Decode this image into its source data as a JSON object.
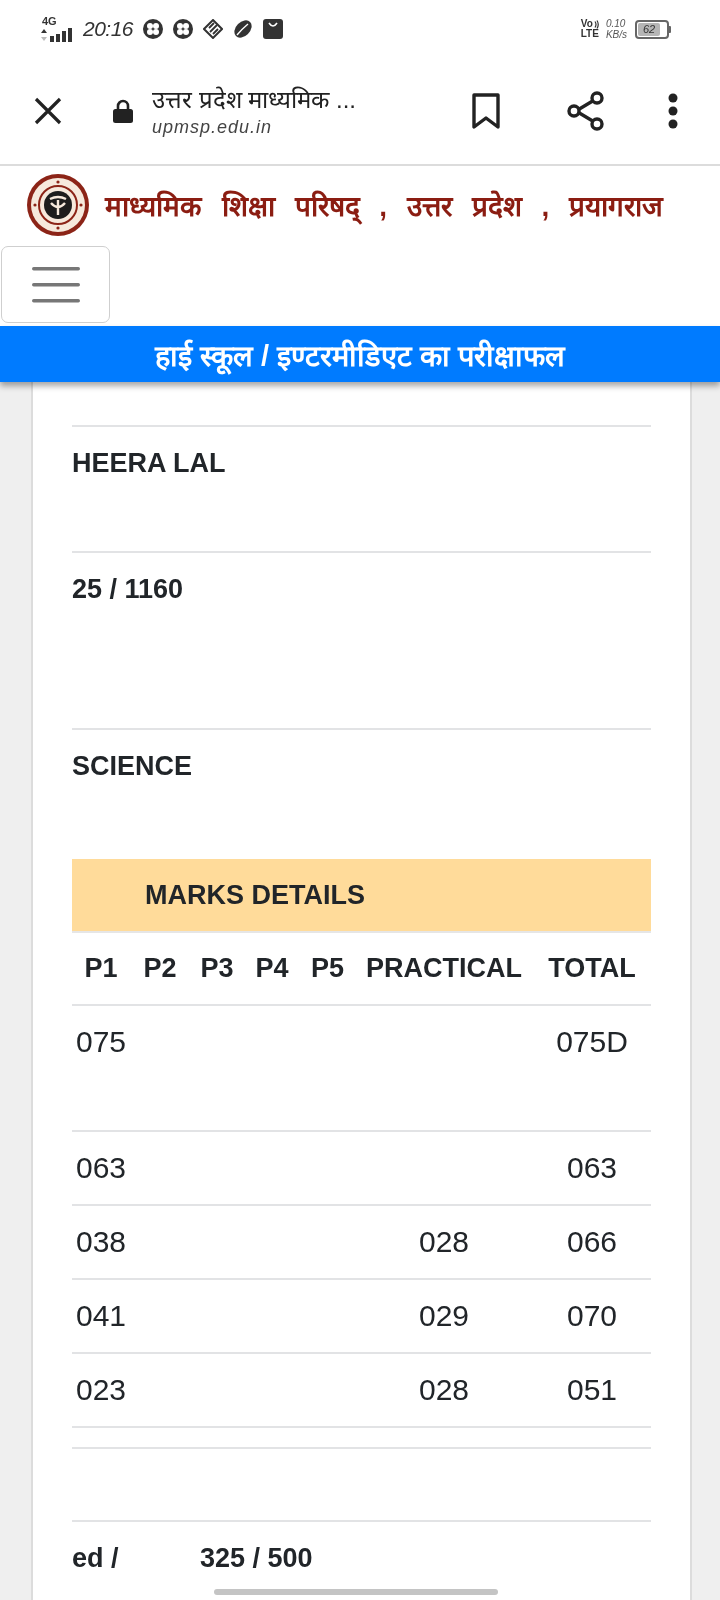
{
  "status_bar": {
    "network_type": "4G",
    "time": "20:16",
    "volte_top": "Vo",
    "volte_bottom": "LTE",
    "speed_value": "0.10",
    "speed_unit": "KB/s",
    "battery_text": "62"
  },
  "browser_bar": {
    "page_title": "उत्तर प्रदेश माध्यमिक ...",
    "url": "upmsp.edu.in"
  },
  "site_header": {
    "title": "माध्यमिक शिक्षा परिषद् , उत्तर प्रदेश , प्रयागराज"
  },
  "banner": {
    "title": "हाई स्कूल / इण्टरमीडिएट का परीक्षाफल"
  },
  "result_rows": [
    {
      "value": "HEERA LAL"
    },
    {
      "value": "25 / 1160"
    },
    {
      "value": "SCIENCE"
    }
  ],
  "marks_table": {
    "title": "MARKS DETAILS",
    "columns": {
      "p1": "P1",
      "p2": "P2",
      "p3": "P3",
      "p4": "P4",
      "p5": "P5",
      "practical": "PRACTICAL",
      "total": "TOTAL"
    },
    "rows": [
      {
        "p1": "075",
        "total": "075D"
      },
      {
        "p1": "063",
        "total": "063"
      },
      {
        "p1": "038",
        "practical": "028",
        "total": "066"
      },
      {
        "p1": "041",
        "practical": "029",
        "total": "070"
      },
      {
        "p1": "023",
        "practical": "028",
        "total": "051"
      }
    ]
  },
  "total_row": {
    "label": "ed /",
    "value": "325 / 500"
  }
}
